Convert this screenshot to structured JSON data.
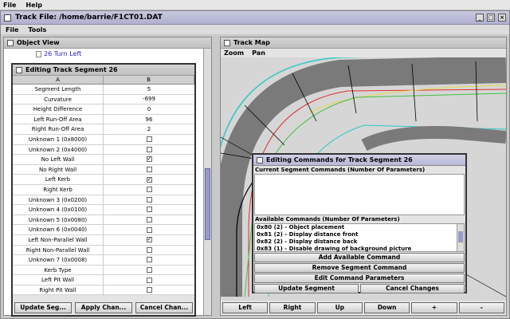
{
  "app_menu": [
    "File",
    "Help"
  ],
  "window": {
    "title": "Track File: /home/barrie/F1CT01.DAT"
  },
  "inner_menu": [
    "File",
    "Tools"
  ],
  "object_view": {
    "title": "Object View",
    "selected_item": "26 Turn Left"
  },
  "segment_editor": {
    "title": "Editing Track Segment 26",
    "columns": [
      "A",
      "B"
    ],
    "rows": [
      {
        "label": "Segment Length",
        "value": "5"
      },
      {
        "label": "Curvature",
        "value": "-699"
      },
      {
        "label": "Height Difference",
        "value": "0"
      },
      {
        "label": "Left Run-Off Area",
        "value": "96"
      },
      {
        "label": "Right Run-Off Area",
        "value": "2"
      },
      {
        "label": "Unknown 1 (0x8000)",
        "checked": false
      },
      {
        "label": "Unknown 2 (0x4000)",
        "checked": false
      },
      {
        "label": "No Left Wall",
        "checked": true
      },
      {
        "label": "No Right Wall",
        "checked": false
      },
      {
        "label": "Left Kerb",
        "checked": true
      },
      {
        "label": "Right Kerb",
        "checked": false
      },
      {
        "label": "Unknown 3 (0x0200)",
        "checked": false
      },
      {
        "label": "Unknown 4 (0x0100)",
        "checked": false
      },
      {
        "label": "Unknown 5 (0x0080)",
        "checked": false
      },
      {
        "label": "Unknown 6 (0x0040)",
        "checked": false
      },
      {
        "label": "Left Non-Parallel Wall",
        "checked": true
      },
      {
        "label": "Right Non-Parallel Wall",
        "checked": false
      },
      {
        "label": "Unknown 7 (0x0008)",
        "checked": false
      },
      {
        "label": "Kerb Type",
        "checked": false
      },
      {
        "label": "Left Pit Wall",
        "checked": false
      },
      {
        "label": "Right Pit Wall",
        "checked": false
      }
    ],
    "buttons": [
      "Update Seg...",
      "Apply Chan...",
      "Cancel Chan..."
    ]
  },
  "track_map": {
    "title": "Track Map",
    "menu": [
      "Zoom",
      "Pan"
    ],
    "buttons": [
      "Left",
      "Right",
      "Up",
      "Down",
      "+",
      "-"
    ],
    "colors": {
      "outer": "#30c8c8",
      "mid_red": "#e03030",
      "inner_yellow": "#e8d84a",
      "green": "#40c040",
      "road": "#7a7a7a"
    }
  },
  "commands_dialog": {
    "title": "Editing Commands for Track Segment 26",
    "current_label": "Current Segment Commands (Number Of Parameters)",
    "available_label": "Available Commands (Number Of Parameters)",
    "available": [
      "0x80 (2) - Object placement",
      "0x81 (2) - Display distance front",
      "0x82 (2) - Display distance back",
      "0x83 (1) - Disable drawing of background picture"
    ],
    "buttons": {
      "add": "Add Available Command",
      "remove": "Remove Segment Command",
      "edit": "Edit Command Parameters",
      "update": "Update Segment",
      "cancel": "Cancel Changes"
    }
  }
}
